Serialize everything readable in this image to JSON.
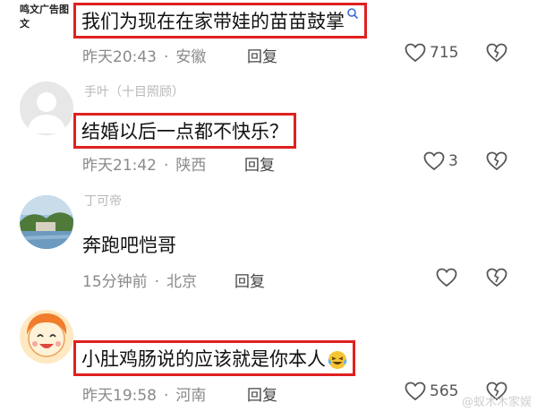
{
  "comments": [
    {
      "avatar_text": "鸣文广告图文",
      "username": "",
      "content": "我们为现在在家带娃的苗苗鼓掌",
      "time": "昨天20:43",
      "location": "安徽",
      "reply": "回复",
      "likes": "715"
    },
    {
      "username": "手叶（十目照顾）",
      "content": "结婚以后一点都不快乐？",
      "time": "昨天21:42",
      "location": "陕西",
      "reply": "回复",
      "likes": "3"
    },
    {
      "username": "丁可帝",
      "content": "奔跑吧恺哥",
      "time": "15分钟前",
      "location": "北京",
      "reply": "回复",
      "likes": ""
    },
    {
      "username": "",
      "content": "小肚鸡肠说的应该就是你本人",
      "time": "昨天19:58",
      "location": "河南",
      "reply": "回复",
      "likes": "565"
    }
  ],
  "watermark": "@蚁木木家娱",
  "colors": {
    "highlight_border": "#e02020",
    "meta_text": "#8a8a8a"
  }
}
